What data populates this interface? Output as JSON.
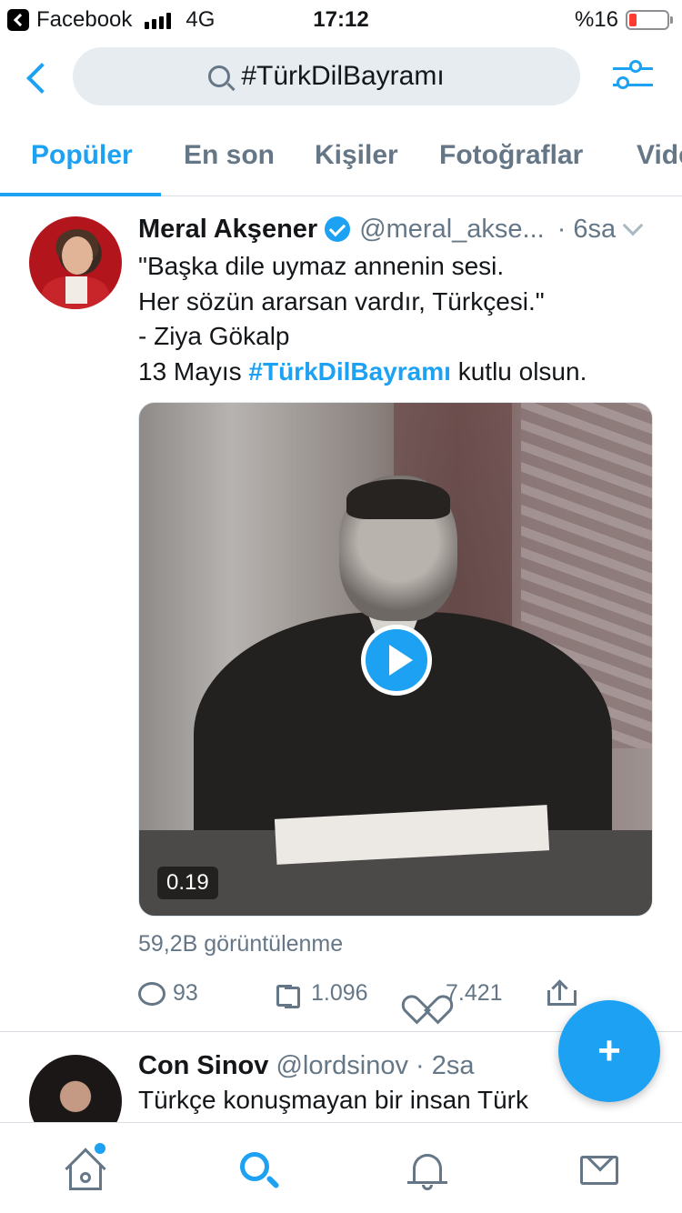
{
  "status_bar": {
    "back_app": "Facebook",
    "network": "4G",
    "time": "17:12",
    "battery": "%16"
  },
  "header": {
    "search_query": "#TürkDilBayramı"
  },
  "tabs": [
    {
      "label": "Popüler",
      "active": true
    },
    {
      "label": "En son",
      "active": false
    },
    {
      "label": "Kişiler",
      "active": false
    },
    {
      "label": "Fotoğraflar",
      "active": false
    },
    {
      "label": "Vide",
      "active": false
    }
  ],
  "tweets": [
    {
      "name": "Meral Akşener",
      "verified": true,
      "handle": "@meral_akse...",
      "time": "· 6sa",
      "lines": [
        "\"Başka dile uymaz annenin sesi.",
        "Her sözün ararsan vardır, Türkçesi.\"",
        "- Ziya Gökalp"
      ],
      "last_line_prefix": "13 Mayıs ",
      "hashtag": "#TürkDilBayramı",
      "last_line_suffix": " kutlu olsun.",
      "video_duration": "0.19",
      "views": "59,2B görüntülenme",
      "replies": "93",
      "retweets": "1.096",
      "likes": "7.421"
    },
    {
      "name": "Con Sinov",
      "handle": "@lordsinov",
      "time": "· 2sa",
      "text": "Türkçe konuşmayan bir insan Türk"
    }
  ],
  "fab_label": "+",
  "colors": {
    "accent": "#1da1f2",
    "secondary_text": "#657786",
    "search_bg": "#e6ecf0"
  },
  "icons": [
    "search-icon",
    "filter-icon",
    "verified-icon",
    "play-icon",
    "reply-icon",
    "retweet-icon",
    "like-icon",
    "share-icon",
    "compose-icon",
    "home-icon",
    "explore-icon",
    "notifications-icon",
    "messages-icon"
  ]
}
